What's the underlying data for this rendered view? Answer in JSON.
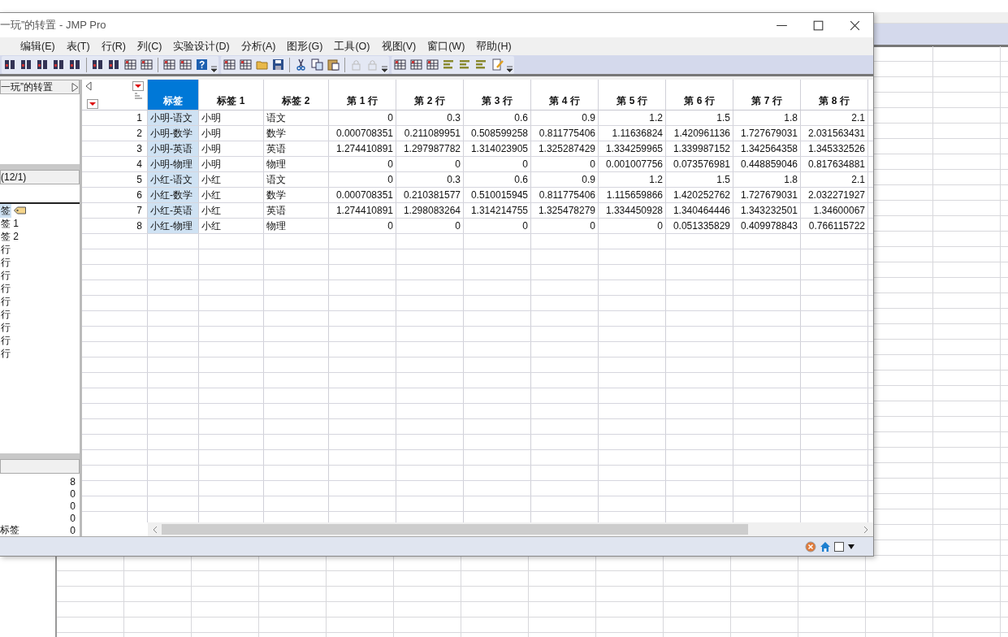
{
  "window": {
    "title": "一玩”的转置 - JMP Pro"
  },
  "menu": [
    "编辑(E)",
    "表(T)",
    "行(R)",
    "列(C)",
    "实验设计(D)",
    "分析(A)",
    "图形(G)",
    "工具(O)",
    "视图(V)",
    "窗口(W)",
    "帮助(H)"
  ],
  "status_bar": {
    "checkbox": {
      "checked": false
    }
  },
  "table_panel": {
    "title": "一玩”的转置"
  },
  "columns_panel": {
    "title": "(12/1)",
    "items": [
      {
        "label": "签",
        "selected": true
      },
      {
        "label": "签 1",
        "selected": false
      },
      {
        "label": "签 2",
        "selected": false
      },
      {
        "label": "行",
        "selected": false
      },
      {
        "label": "行",
        "selected": false
      },
      {
        "label": "行",
        "selected": false
      },
      {
        "label": "行",
        "selected": false
      },
      {
        "label": "行",
        "selected": false
      },
      {
        "label": "行",
        "selected": false
      },
      {
        "label": "行",
        "selected": false
      },
      {
        "label": "行",
        "selected": false
      },
      {
        "label": "行",
        "selected": false
      }
    ]
  },
  "rows_panel": {
    "items": [
      {
        "value": "8"
      },
      {
        "value": "0"
      },
      {
        "value": "0"
      },
      {
        "value": "0"
      },
      {
        "label": "标签",
        "value": "0"
      }
    ]
  },
  "grid": {
    "columns": [
      {
        "label": "标签",
        "kind": "character",
        "selected": true
      },
      {
        "label": "标签 1",
        "kind": "character",
        "selected": false
      },
      {
        "label": "标签 2",
        "kind": "character",
        "selected": false
      },
      {
        "label": "第 1 行",
        "kind": "numeric",
        "selected": false
      },
      {
        "label": "第 2 行",
        "kind": "numeric",
        "selected": false
      },
      {
        "label": "第 3 行",
        "kind": "numeric",
        "selected": false
      },
      {
        "label": "第 4 行",
        "kind": "numeric",
        "selected": false
      },
      {
        "label": "第 5 行",
        "kind": "numeric",
        "selected": false
      },
      {
        "label": "第 6 行",
        "kind": "numeric",
        "selected": false
      },
      {
        "label": "第 7 行",
        "kind": "numeric",
        "selected": false
      },
      {
        "label": "第 8 行",
        "kind": "numeric",
        "selected": false
      }
    ],
    "rows": [
      {
        "number": "1",
        "cells": [
          "小明-语文",
          "小明",
          "语文",
          "0",
          "0.3",
          "0.6",
          "0.9",
          "1.2",
          "1.5",
          "1.8",
          "2.1"
        ]
      },
      {
        "number": "2",
        "cells": [
          "小明-数学",
          "小明",
          "数学",
          "0.000708351",
          "0.211089951",
          "0.508599258",
          "0.811775406",
          "1.11636824",
          "1.420961136",
          "1.727679031",
          "2.031563431"
        ]
      },
      {
        "number": "3",
        "cells": [
          "小明-英语",
          "小明",
          "英语",
          "1.274410891",
          "1.297987782",
          "1.314023905",
          "1.325287429",
          "1.334259965",
          "1.339987152",
          "1.342564358",
          "1.345332526"
        ]
      },
      {
        "number": "4",
        "cells": [
          "小明-物理",
          "小明",
          "物理",
          "0",
          "0",
          "0",
          "0",
          "0.001007756",
          "0.073576981",
          "0.448859046",
          "0.817634881"
        ]
      },
      {
        "number": "5",
        "cells": [
          "小红-语文",
          "小红",
          "语文",
          "0",
          "0.3",
          "0.6",
          "0.9",
          "1.2",
          "1.5",
          "1.8",
          "2.1"
        ]
      },
      {
        "number": "6",
        "cells": [
          "小红-数学",
          "小红",
          "数学",
          "0.000708351",
          "0.210381577",
          "0.510015945",
          "0.811775406",
          "1.115659866",
          "1.420252762",
          "1.727679031",
          "2.032271927"
        ]
      },
      {
        "number": "7",
        "cells": [
          "小红-英语",
          "小红",
          "英语",
          "1.274410891",
          "1.298083264",
          "1.314214755",
          "1.325478279",
          "1.334450928",
          "1.340464446",
          "1.343232501",
          "1.34600067"
        ]
      },
      {
        "number": "8",
        "cells": [
          "小红-物理",
          "小红",
          "物理",
          "0",
          "0",
          "0",
          "0",
          "0",
          "0.051335829",
          "0.409978843",
          "0.766115722"
        ]
      }
    ]
  }
}
